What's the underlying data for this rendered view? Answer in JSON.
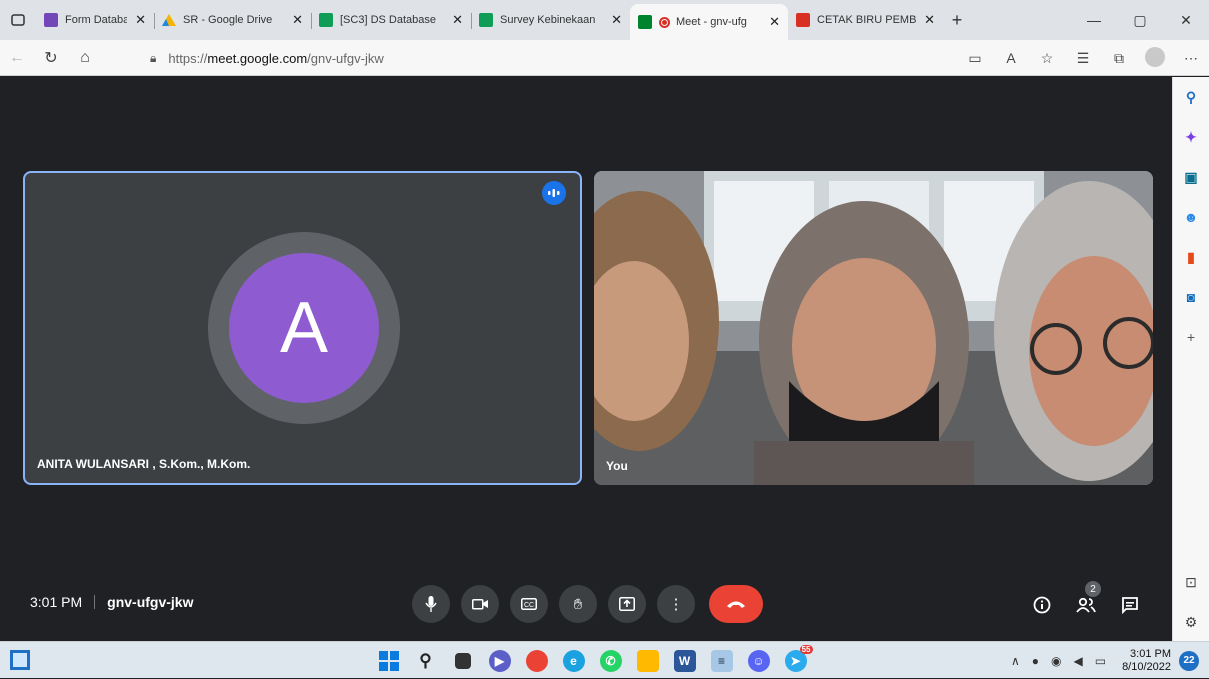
{
  "browser": {
    "tabs": [
      {
        "title": "Form Database Pes",
        "favicon_color": "#7248b9"
      },
      {
        "title": "SR - Google Drive",
        "favicon_color": "#f4b400"
      },
      {
        "title": "[SC3] DS Database",
        "favicon_color": "#0f9d58"
      },
      {
        "title": "Survey Kebinekaan",
        "favicon_color": "#0f9d58"
      },
      {
        "title": "Meet - gnv-ufg",
        "favicon_color": "#00832d",
        "active": true
      },
      {
        "title": "CETAK BIRU PEMBA",
        "favicon_color": "#d93025"
      }
    ],
    "url_prefix": "https://",
    "url_host": "meet.google.com",
    "url_path": "/gnv-ufgv-jkw"
  },
  "meet": {
    "participants": [
      {
        "name": "ANITA WULANSARI , S.Kom., M.Kom.",
        "avatar_letter": "A",
        "avatar_color": "#8e5bd1",
        "speaking": true
      },
      {
        "name": "You"
      }
    ],
    "time": "3:01 PM",
    "meeting_code": "gnv-ufgv-jkw",
    "people_count": "2"
  },
  "taskbar": {
    "time": "3:01 PM",
    "date": "8/10/2022",
    "notifications": "22",
    "chrome_badge": "55"
  },
  "colors": {
    "accent": "#8ab4f8",
    "end_call": "#ea4335",
    "stage_bg": "#202124"
  }
}
